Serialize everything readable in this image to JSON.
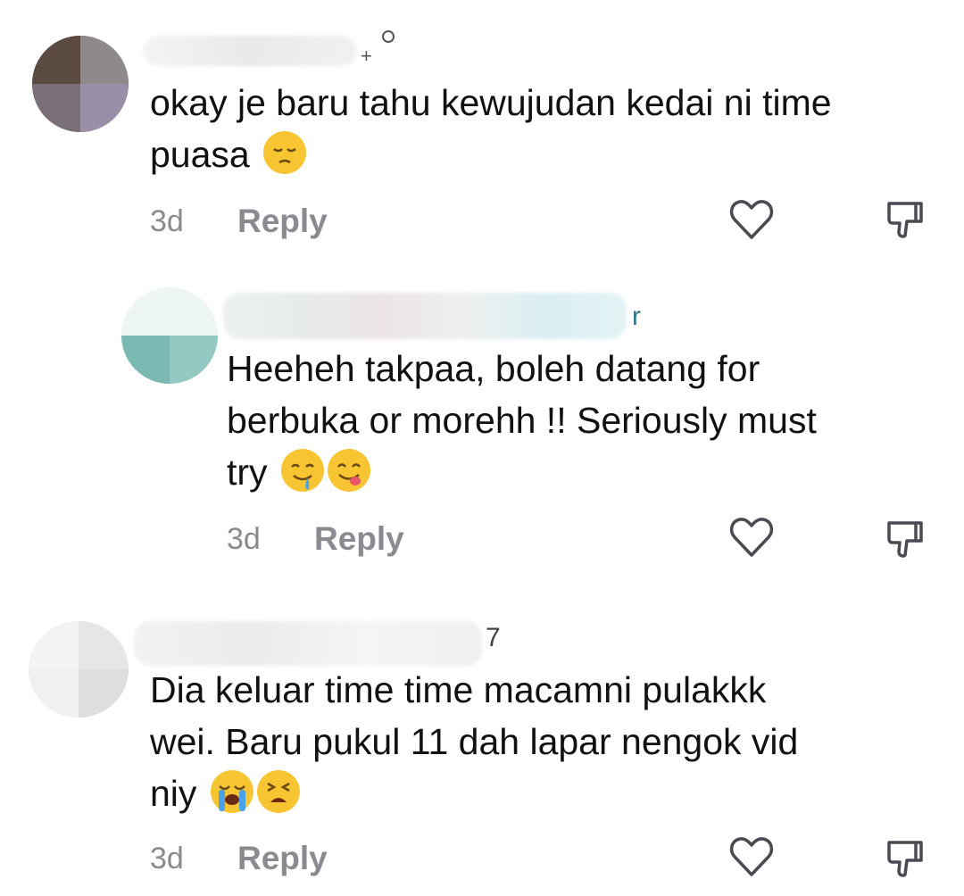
{
  "comments": [
    {
      "username_tail": "+",
      "text": "okay je baru tahu kewujudan kedai ni time puasa",
      "text_lines": [
        "okay je baru tahu kewujudan kedai ni time",
        "puasa"
      ],
      "emojis": [
        "pensive-face"
      ],
      "time": "3d",
      "reply_label": "Reply"
    },
    {
      "username_tail": "r",
      "text": "Heeheh takpaa, boleh datang for berbuka or morehh !! Seriously must try",
      "text_lines": [
        "Heeheh takpaa, boleh datang for",
        "berbuka or morehh !! Seriously must",
        "try"
      ],
      "emojis": [
        "drooling-face",
        "face-savoring-food"
      ],
      "time": "3d",
      "reply_label": "Reply"
    },
    {
      "username_tail": "7",
      "text": "Dia keluar time time macamni pulakkk wei. Baru pukul 11 dah lapar nengok vid niy",
      "text_lines": [
        "Dia keluar time time macamni pulakkk",
        "wei. Baru pukul 11 dah lapar nengok vid",
        "niy"
      ],
      "emojis": [
        "loudly-crying-face",
        "weary-face"
      ],
      "time": "3d",
      "reply_label": "Reply"
    }
  ],
  "icons": {
    "like": "heart-outline-icon",
    "dislike": "thumbs-down-outline-icon"
  },
  "colors": {
    "text": "#111111",
    "meta": "#8a8b91",
    "emoji_yellow": "#f7c531"
  }
}
